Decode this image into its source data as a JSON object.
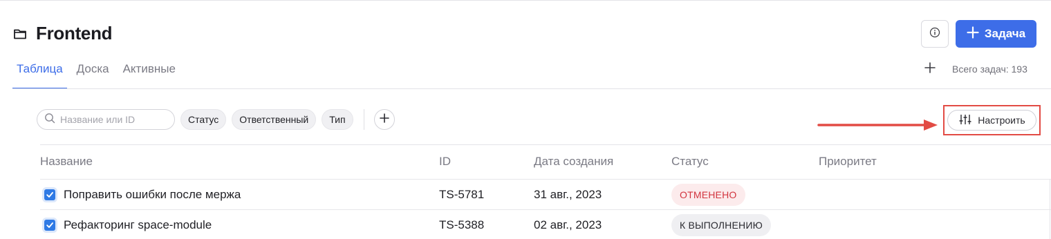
{
  "project": {
    "title": "Frontend"
  },
  "header": {
    "new_task_label": "Задача"
  },
  "tabs": [
    {
      "label": "Таблица",
      "active": true
    },
    {
      "label": "Доска",
      "active": false
    },
    {
      "label": "Активные",
      "active": false
    }
  ],
  "total_tasks": "Всего задач: 193",
  "filters": {
    "search_placeholder": "Название или ID",
    "chips": [
      "Статус",
      "Ответственный",
      "Тип"
    ]
  },
  "configure_label": "Настроить",
  "table": {
    "columns": [
      "Название",
      "ID",
      "Дата создания",
      "Статус",
      "Приоритет"
    ],
    "rows": [
      {
        "name": "Поправить ошибки после мержа",
        "id": "TS-5781",
        "created": "31 авг., 2023",
        "status": "ОТМЕНЕНО",
        "status_kind": "cancelled",
        "checked": true
      },
      {
        "name": "Рефакторинг space-module",
        "id": "TS-5388",
        "created": "02 авг., 2023",
        "status": "К ВЫПОЛНЕНИЮ",
        "status_kind": "todo",
        "checked": true
      }
    ]
  },
  "colors": {
    "accent": "#3d6de8",
    "annotation": "#e24b44",
    "cancelled_text": "#d2343e",
    "checkbox": "#2f7ae5"
  },
  "icons": [
    "folder-icon",
    "info-icon",
    "plus-icon",
    "search-icon",
    "sliders-icon",
    "checkbox-checked-icon"
  ]
}
